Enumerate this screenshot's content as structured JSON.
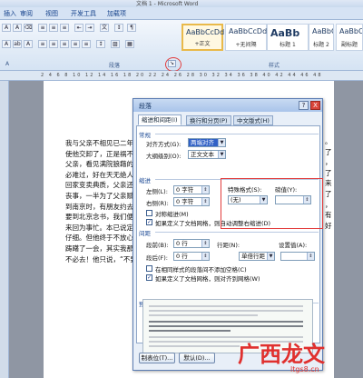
{
  "window": {
    "title": "文档 1 - Microsoft Word"
  },
  "ribbon": {
    "tabs": [
      "插入",
      "审阅",
      "视图",
      "开发工具",
      "加载项"
    ],
    "paragraph_group_label": "段落",
    "styles_group_label": "样式",
    "styles": [
      {
        "sample": "AaBbCcDd",
        "name": "+正文",
        "active": true
      },
      {
        "sample": "AaBbCcDd",
        "name": "+无间隔",
        "active": false
      },
      {
        "sample": "AaBb",
        "name": "标题 1",
        "active": false
      },
      {
        "sample": "AaBbC",
        "name": "标题 2",
        "active": false
      },
      {
        "sample": "AaBbC",
        "name": "标题",
        "active": false
      },
      {
        "sample": "AaBbCo",
        "name": "副标题",
        "active": false
      }
    ]
  },
  "ruler": {
    "numbers": "2 4 6 8 10 12 14 16 18 20 22 24 26 28 30 32 34 36 38 40 42 44 46 48"
  },
  "document": {
    "lines": [
      "我与父亲不相见已二年余",
      "使他交卸了，正是祸不单行",
      "父亲，看见满院狼藉的东西",
      "必难过，好在天无绝人之路",
      "回家变卖典质，父亲还了亏",
      "丧事，一半为了父亲赋闲。",
      "到南京时，有朋友约去游逛",
      "要到北京念书，我们便同行",
      "来回为事忙。本已说定不送",
      "仔细。但他终于不放心，怕",
      "踌躇了一会，其实我那年已",
      "不必去！他只说，“不要紧"
    ],
    "right_marks": [
      "。",
      "了",
      "，",
      "了",
      "来",
      "了",
      "，",
      "有",
      "好"
    ]
  },
  "dialog": {
    "title": "段落",
    "help_button": "?",
    "close_button": "X",
    "tabs": [
      "缩进和间距(I)",
      "换行和分页(P)",
      "中文版式(H)"
    ],
    "general": {
      "section": "常规",
      "alignment_label": "对齐方式(G):",
      "alignment_value": "两端对齐",
      "outline_label": "大纲级别(O):",
      "outline_value": "正文文本"
    },
    "indent": {
      "section": "缩进",
      "left_label": "左侧(L):",
      "left_value": "0 字符",
      "right_label": "右侧(R):",
      "right_value": "0 字符",
      "special_label": "特殊格式(S):",
      "special_value": "(无)",
      "by_label": "磅值(Y):",
      "by_value": "",
      "mirror_label": "对称缩进(M)",
      "mirror_checked": false,
      "grid_label": "如果定义了文档网格，则自动调整右缩进(D)",
      "grid_checked": true
    },
    "spacing": {
      "section": "间距",
      "before_label": "段前(B):",
      "before_value": "0 行",
      "after_label": "段后(F):",
      "after_value": "0 行",
      "line_label": "行距(N):",
      "line_value": "单倍行距",
      "at_label": "设置值(A):",
      "at_value": "",
      "no_space_label": "在相同样式的段落间不添加空格(C)",
      "no_space_checked": false,
      "snap_label": "如果定义了文档网格，则对齐到网格(W)",
      "snap_checked": true
    },
    "preview": {
      "section": "预览"
    },
    "buttons": {
      "tabs": "制表位(T)...",
      "default": "默认(D)..."
    }
  },
  "watermark": {
    "text": "广西龙文",
    "url": "ltgs8.cn"
  },
  "colors": {
    "highlight": "#e23b3b",
    "ribbon": "#d6e3f4",
    "dialog_bg": "#e8eff8"
  }
}
